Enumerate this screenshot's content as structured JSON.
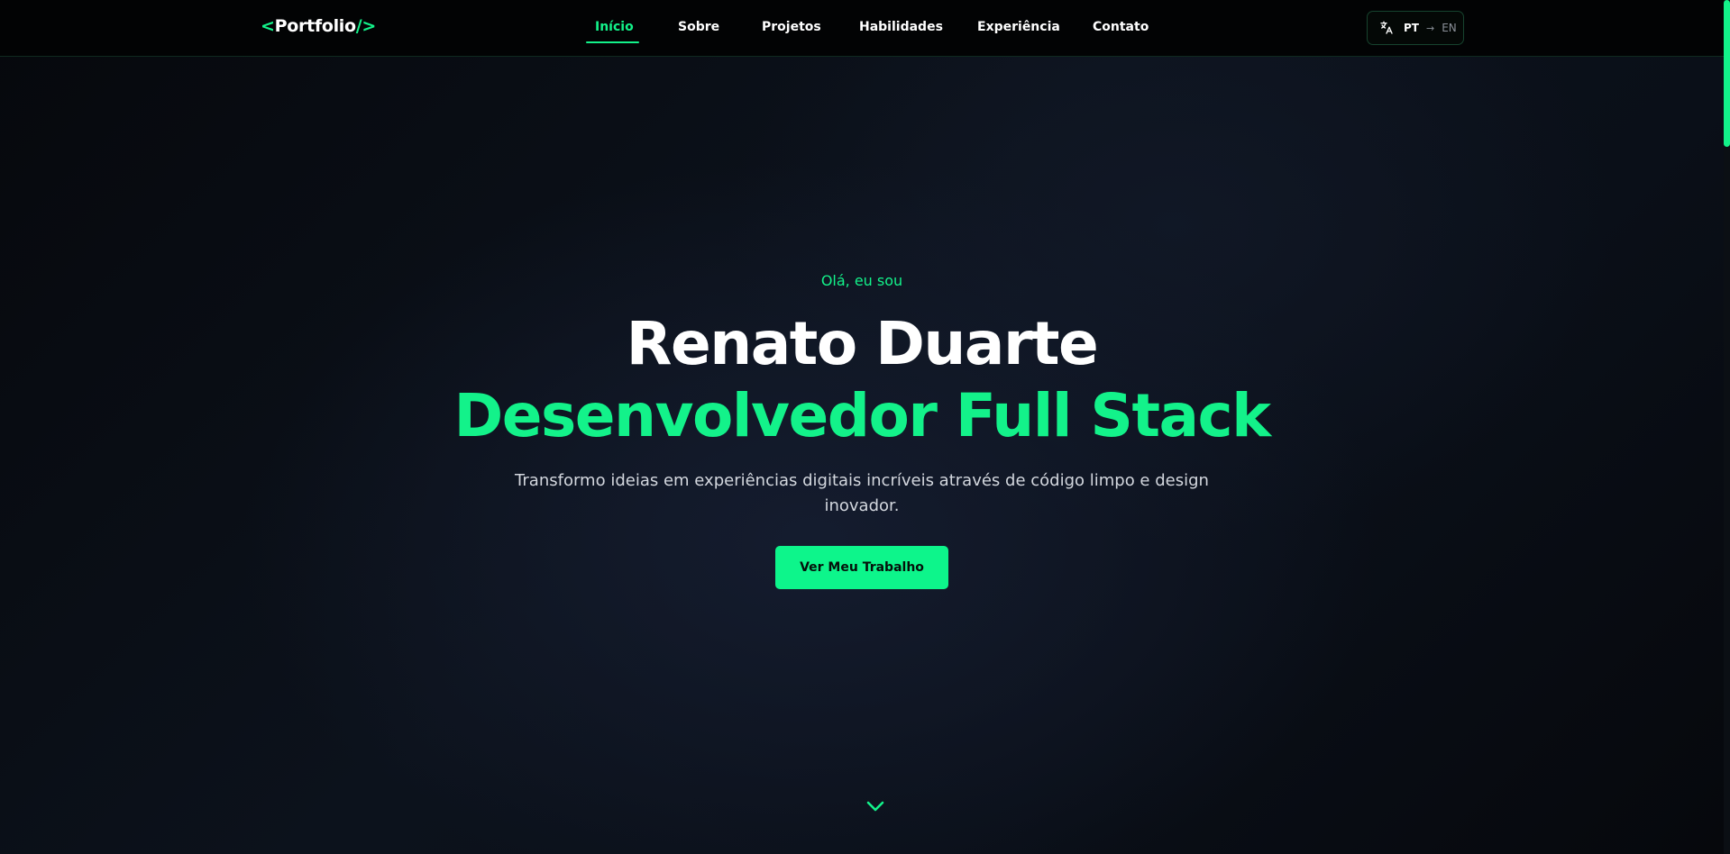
{
  "nav": {
    "logo": {
      "open": "<",
      "word": "Portfolio",
      "close": "/>"
    },
    "items": [
      {
        "label": "Início",
        "active": true
      },
      {
        "label": "Sobre",
        "active": false
      },
      {
        "label": "Projetos",
        "active": false
      },
      {
        "label": "Habilidades",
        "active": false
      },
      {
        "label": "Experiência",
        "active": false
      },
      {
        "label": "Contato",
        "active": false
      }
    ],
    "language": {
      "icon": "translate-icon",
      "current": "PT",
      "arrow": "→",
      "target": "EN"
    }
  },
  "hero": {
    "greeting": "Olá, eu sou",
    "name": "Renato Duarte",
    "role": "Desenvolvedor Full Stack",
    "description": "Transformo ideias em experiências digitais incríveis através de código limpo e design inovador.",
    "cta_label": "Ver Meu Trabalho",
    "scroll_icon": "chevron-down-icon"
  },
  "colors": {
    "accent": "#13f28a",
    "background": "#080b12",
    "navbar": "#020304",
    "text": "#ffffff",
    "muted": "#8a8f98"
  }
}
